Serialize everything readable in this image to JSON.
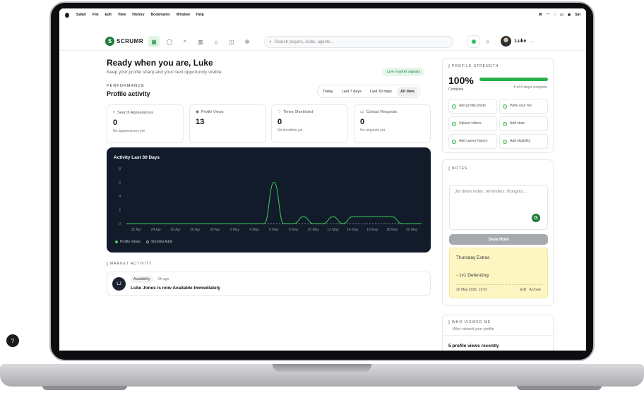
{
  "menubar": {
    "items": [
      "Safari",
      "File",
      "Edit",
      "View",
      "History",
      "Bookmarks",
      "Window",
      "Help"
    ],
    "clock": "Sat"
  },
  "nav": {
    "logo_text": "SCRUMR",
    "search_placeholder": "Search players, clubs, agents...",
    "user_name": "Luke",
    "icons": [
      "dashboard-icon",
      "profile-icon",
      "search-icon",
      "clubs-icon",
      "stadium-icon",
      "matches-icon",
      "settings-icon"
    ]
  },
  "header": {
    "greeting": "Ready when you are, Luke",
    "subtitle": "Keep your profile sharp and your next opportunity visible.",
    "live_badge": "Live market signals"
  },
  "performance": {
    "label": "PERFORMANCE",
    "title": "Profile activity",
    "ranges": [
      "Today",
      "Last 7 days",
      "Last 30 days",
      "All time"
    ],
    "active_range": "All time"
  },
  "stats": [
    {
      "label": "Search Appearances",
      "value": "0",
      "note": "No appearances yet"
    },
    {
      "label": "Profile Views",
      "value": "13",
      "note": ""
    },
    {
      "label": "Times Shortlisted",
      "value": "0",
      "note": "No shortlists yet"
    },
    {
      "label": "Contact Requests",
      "value": "0",
      "note": "No requests yet"
    }
  ],
  "chart_data": {
    "type": "line",
    "title": "Activity Last 30 Days",
    "xlabel": "",
    "ylabel": "",
    "ylim": [
      0,
      8
    ],
    "yticks": [
      0,
      2,
      4,
      6,
      8
    ],
    "x_ticks": [
      "22 Apr",
      "24 Apr",
      "26 Apr",
      "28 Apr",
      "30 Apr",
      "2 May",
      "4 May",
      "6 May",
      "8 May",
      "10 May",
      "12 May",
      "14 May",
      "16 May",
      "18 May",
      "20 May"
    ],
    "x": [
      "21 Apr",
      "22 Apr",
      "23 Apr",
      "24 Apr",
      "25 Apr",
      "26 Apr",
      "27 Apr",
      "28 Apr",
      "29 Apr",
      "30 Apr",
      "1 May",
      "2 May",
      "3 May",
      "4 May",
      "5 May",
      "6 May",
      "7 May",
      "8 May",
      "9 May",
      "10 May",
      "11 May",
      "12 May",
      "13 May",
      "14 May",
      "15 May",
      "16 May",
      "17 May",
      "18 May",
      "19 May",
      "20 May",
      "21 May"
    ],
    "series": [
      {
        "name": "Profile Views",
        "color": "#3ecf5a",
        "values": [
          0,
          0,
          0,
          0,
          0,
          0,
          0,
          0,
          0,
          0,
          0,
          0,
          0,
          0,
          0,
          6,
          0,
          0,
          1,
          0,
          0,
          1,
          0,
          1,
          1,
          1,
          1,
          1,
          0,
          0,
          0
        ]
      },
      {
        "name": "Shortlist Adds",
        "color": "#9aa3ad",
        "values": [
          0,
          0,
          0,
          0,
          0,
          0,
          0,
          0,
          0,
          0,
          0,
          0,
          0,
          0,
          0,
          0,
          0,
          0,
          0,
          0,
          0,
          0,
          0,
          0,
          0,
          0,
          0,
          0,
          0,
          0,
          0
        ]
      }
    ],
    "grid": false,
    "legend": "bottom-left"
  },
  "market": {
    "label": "MARKET ACTIVITY",
    "avatar_text": "LJ",
    "chip": "Availability",
    "time": "9h ago",
    "message": "Luke Jones is now Available Immediately"
  },
  "strength": {
    "label": "PROFILE STRENGTH",
    "percent_text": "100%",
    "progress": 100,
    "complete_label": "Complete",
    "steps_text": "8 of 8 steps complete",
    "tasks": [
      "Add profile photo",
      "Write your bio",
      "Upload videos",
      "Add stats",
      "Add career history",
      "Add eligibility"
    ]
  },
  "notes": {
    "label": "NOTES",
    "placeholder": "Jot down notes, reminders, thoughts...",
    "save_label": "Save Note",
    "note_title": "Thursday Extras",
    "note_body": "- 1v1 Defending",
    "note_date": "20 May 2026, 19:07",
    "edit_label": "Edit",
    "archive_label": "Archive"
  },
  "viewed": {
    "label": "WHO VIEWED ME",
    "subtitle": "Who viewed your profile",
    "count_text": "5 profile views recently"
  },
  "colors": {
    "brand": "#1f7a3a",
    "accent_green": "#27b24a",
    "chart_bg": "#111b2a",
    "sticky_bg": "#fdf6c2"
  }
}
